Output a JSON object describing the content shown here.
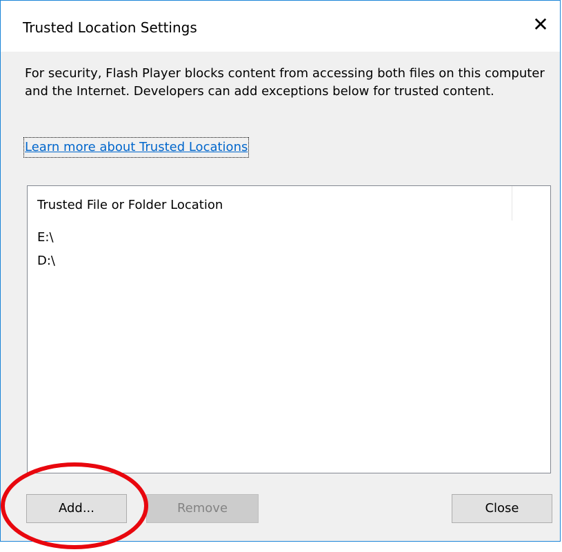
{
  "dialog": {
    "title": "Trusted Location Settings",
    "close_glyph": "✕"
  },
  "description": {
    "text": "For security, Flash Player blocks content from accessing both files on this computer and the Internet. Developers can add exceptions below for trusted content."
  },
  "learn_more_link": {
    "text": "Learn more about Trusted Locations"
  },
  "list": {
    "column_header": "Trusted File or Folder Location",
    "items": [
      {
        "path": "E:\\"
      },
      {
        "path": "D:\\"
      }
    ]
  },
  "buttons": {
    "add_label": "Add...",
    "remove_label": "Remove",
    "close_label": "Close"
  },
  "annotation": {
    "shape": "ellipse",
    "color": "#e8070e"
  }
}
